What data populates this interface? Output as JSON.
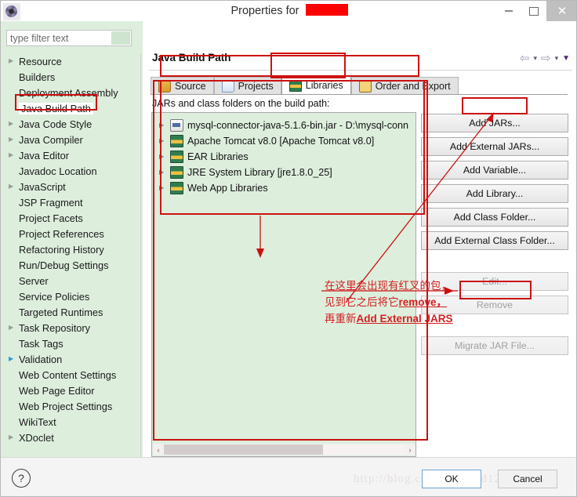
{
  "window": {
    "title_prefix": "Properties for",
    "project_name_redacted": "",
    "icon": "properties-gear-icon",
    "minimize": "–",
    "maximize": "▢",
    "close": "✕"
  },
  "sidebar": {
    "filter_placeholder": "type filter text",
    "filter_value": "",
    "items": [
      {
        "label": "Resource",
        "expandable": true,
        "selected": false
      },
      {
        "label": "Builders",
        "expandable": false,
        "selected": false
      },
      {
        "label": "Deployment Assembly",
        "expandable": false,
        "selected": false
      },
      {
        "label": "Java Build Path",
        "expandable": false,
        "selected": true
      },
      {
        "label": "Java Code Style",
        "expandable": true,
        "selected": false
      },
      {
        "label": "Java Compiler",
        "expandable": true,
        "selected": false
      },
      {
        "label": "Java Editor",
        "expandable": true,
        "selected": false
      },
      {
        "label": "Javadoc Location",
        "expandable": false,
        "selected": false
      },
      {
        "label": "JavaScript",
        "expandable": true,
        "selected": false
      },
      {
        "label": "JSP Fragment",
        "expandable": false,
        "selected": false
      },
      {
        "label": "Project Facets",
        "expandable": false,
        "selected": false
      },
      {
        "label": "Project References",
        "expandable": false,
        "selected": false
      },
      {
        "label": "Refactoring History",
        "expandable": false,
        "selected": false
      },
      {
        "label": "Run/Debug Settings",
        "expandable": false,
        "selected": false
      },
      {
        "label": "Server",
        "expandable": false,
        "selected": false
      },
      {
        "label": "Service Policies",
        "expandable": false,
        "selected": false
      },
      {
        "label": "Targeted Runtimes",
        "expandable": false,
        "selected": false
      },
      {
        "label": "Task Repository",
        "expandable": true,
        "selected": false
      },
      {
        "label": "Task Tags",
        "expandable": false,
        "selected": false
      },
      {
        "label": "Validation",
        "expandable": true,
        "expand_blue": true,
        "selected": false
      },
      {
        "label": "Web Content Settings",
        "expandable": false,
        "selected": false
      },
      {
        "label": "Web Page Editor",
        "expandable": false,
        "selected": false
      },
      {
        "label": "Web Project Settings",
        "expandable": false,
        "selected": false
      },
      {
        "label": "WikiText",
        "expandable": false,
        "selected": false
      },
      {
        "label": "XDoclet",
        "expandable": true,
        "selected": false
      }
    ]
  },
  "content": {
    "page_title": "Java Build Path",
    "nav": {
      "back": "back-arrow",
      "back_menu": "chevron-down-icon",
      "forward": "forward-arrow",
      "forward_menu": "chevron-down-icon",
      "view_menu": "view-menu-triangle"
    },
    "tabs": [
      {
        "label": "Source",
        "icon": "source-folder-icon",
        "active": false
      },
      {
        "label": "Projects",
        "icon": "projects-folder-icon",
        "active": false
      },
      {
        "label": "Libraries",
        "icon": "libraries-books-icon",
        "active": true
      },
      {
        "label": "Order and Export",
        "icon": "order-export-icon",
        "active": false
      }
    ],
    "list_label": "JARs and class folders on the build path:",
    "list_items": [
      {
        "label": "mysql-connector-java-5.1.6-bin.jar - D:\\mysql-conn",
        "icon": "jar-icon",
        "expandable": true
      },
      {
        "label": "Apache Tomcat v8.0 [Apache Tomcat v8.0]",
        "icon": "library-icon",
        "expandable": true
      },
      {
        "label": "EAR Libraries",
        "icon": "library-icon",
        "expandable": true
      },
      {
        "label": "JRE System Library [jre1.8.0_25]",
        "icon": "library-icon",
        "expandable": true
      },
      {
        "label": "Web App Libraries",
        "icon": "library-icon",
        "expandable": true
      }
    ],
    "scrollbar": {
      "left_arrow": "‹",
      "right_arrow": "›",
      "thumb_percent": 66
    },
    "buttons": [
      {
        "label": "Add JARs...",
        "enabled": true,
        "group": 1
      },
      {
        "label": "Add External JARs...",
        "enabled": true,
        "group": 1
      },
      {
        "label": "Add Variable...",
        "enabled": true,
        "group": 1
      },
      {
        "label": "Add Library...",
        "enabled": true,
        "group": 1
      },
      {
        "label": "Add Class Folder...",
        "enabled": true,
        "group": 1
      },
      {
        "label": "Add External Class Folder...",
        "enabled": true,
        "group": 1
      },
      {
        "label": "Edit...",
        "enabled": false,
        "group": 2
      },
      {
        "label": "Remove",
        "enabled": false,
        "group": 2
      },
      {
        "label": "Migrate JAR File...",
        "enabled": false,
        "group": 3
      }
    ]
  },
  "annotation": {
    "line1": "在这里会出现有红叉的包，",
    "line2_prefix": "见到它之后将它",
    "line2_emph": "remove，",
    "line3_prefix": "再重新",
    "line3_emph": "Add External JARS",
    "color": "#d42020"
  },
  "footer": {
    "help": "?",
    "ok": "OK",
    "cancel": "Cancel",
    "watermark": "http://blog.csdn.net/jdzd123"
  }
}
